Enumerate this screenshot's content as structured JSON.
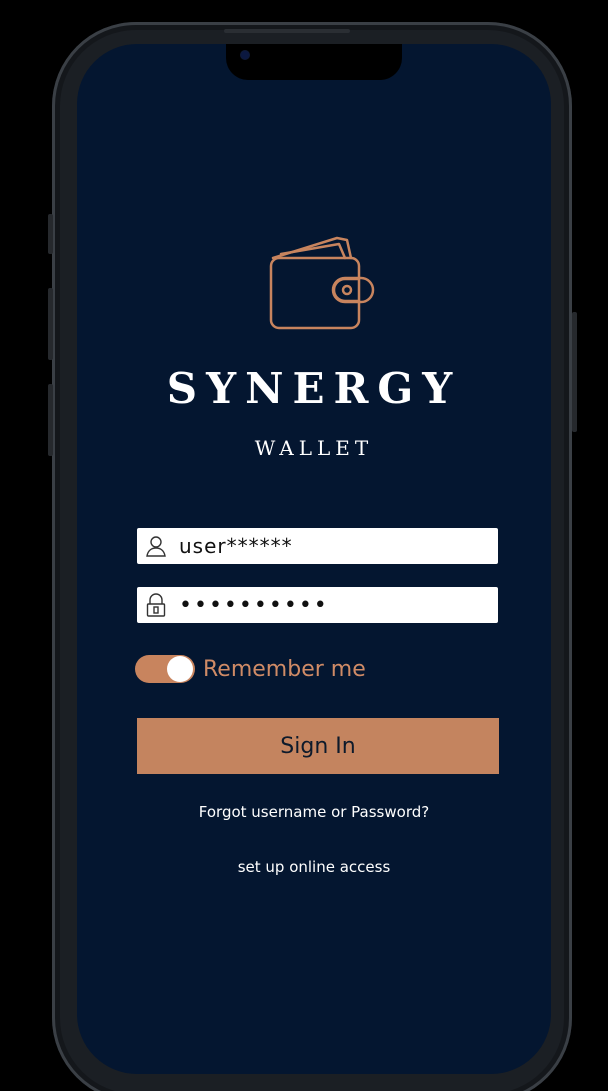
{
  "brand": {
    "title": "SYNERGY",
    "subtitle": "WALLET",
    "logo_icon": "wallet-icon"
  },
  "login": {
    "username_value": "user******",
    "username_icon": "user-icon",
    "password_value": "••••••••••",
    "password_icon": "lock-icon",
    "remember_label": "Remember me",
    "remember_on": true,
    "signin_label": "Sign In",
    "forgot_link": "Forgot  username or Password?",
    "setup_link": "set up online access"
  },
  "colors": {
    "background": "#041630",
    "accent": "#c4845f",
    "text": "#ffffff"
  }
}
